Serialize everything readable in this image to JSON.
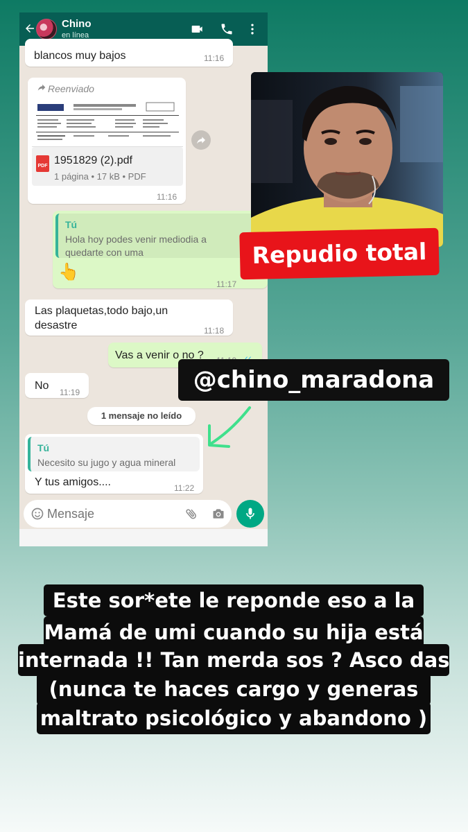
{
  "chat_header": {
    "contact_name": "Chino",
    "status": "en línea"
  },
  "messages": {
    "m1": {
      "text": "blancos muy bajos",
      "time": "11:16"
    },
    "m2": {
      "forwarded_label": "Reenviado",
      "file_name": "1951829 (2).pdf",
      "file_meta": "1 página • 17 kB • PDF",
      "time": "11:16"
    },
    "m3": {
      "quote_author": "Tú",
      "quote_text_1": "Hola hoy podes venir mediodia a",
      "quote_text_2": "quedarte con uma",
      "emoji": "👆",
      "time": "11:17"
    },
    "m4": {
      "text_1": "Las plaquetas,todo bajo,un",
      "text_2": "desastre",
      "time": "11:18"
    },
    "m5": {
      "text": "Vas a venir o no ?",
      "time": "11:19",
      "ticks": "✓✓"
    },
    "m6": {
      "text": "No",
      "time": "11:19"
    },
    "unread_label": "1 mensaje no leído",
    "m7": {
      "quote_author": "Tú",
      "quote_text": "Necesito su jugo y agua mineral",
      "text": "Y tus amigos....",
      "time": "11:22"
    }
  },
  "input": {
    "placeholder": "Mensaje"
  },
  "overlays": {
    "repudio": "Repudio total",
    "handle": "@chino_maradona",
    "caption_lines": [
      "Este sor*ete le reponde eso a la",
      "Mamá de umi cuando su hija está",
      "internada !! Tan merda sos ? Asco das",
      "(nunca te haces cargo y generas",
      "maltrato psicológico y abandono )"
    ]
  },
  "colors": {
    "header": "#075e54",
    "outgoing_bubble": "#dcf8c6",
    "accent_green": "#00a884",
    "repudio_red": "#e8141a"
  }
}
